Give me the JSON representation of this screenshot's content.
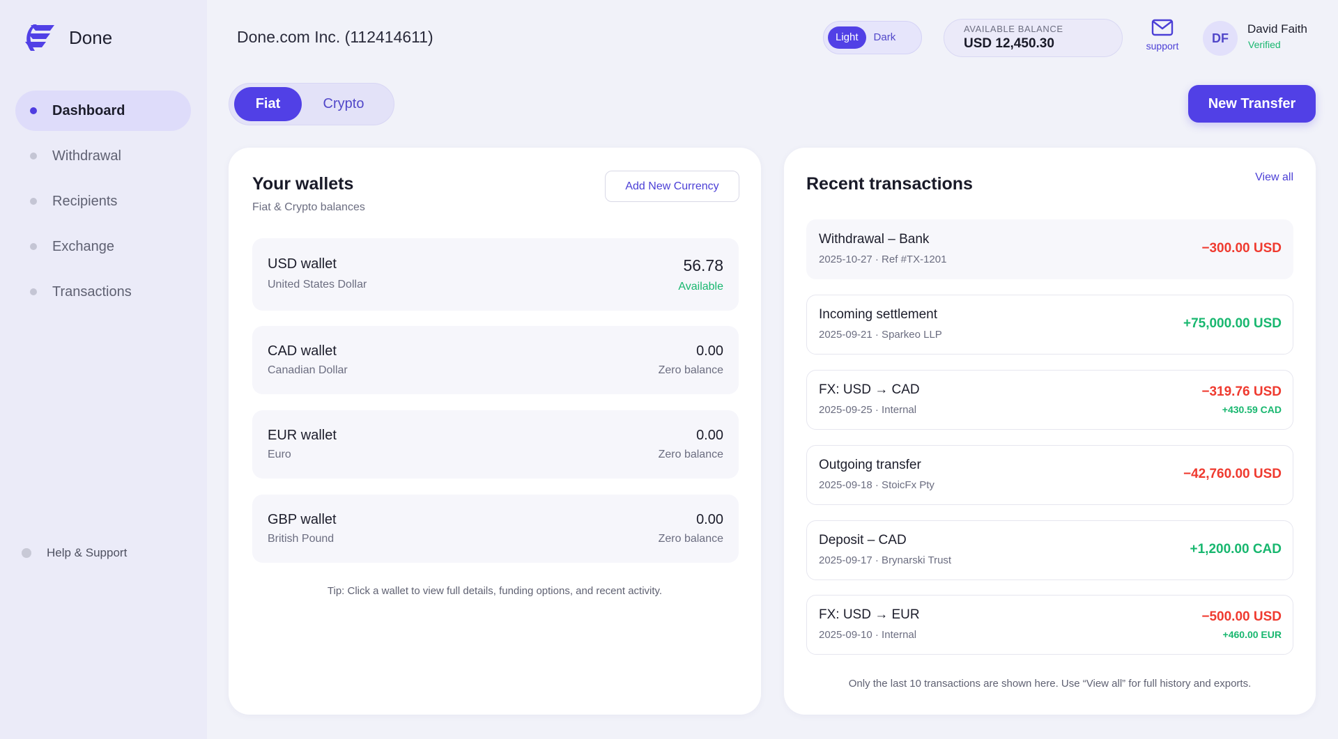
{
  "brand": {
    "name": "Done"
  },
  "sidebar": {
    "items": [
      {
        "label": "Dashboard",
        "active": true
      },
      {
        "label": "Withdrawal",
        "active": false
      },
      {
        "label": "Recipients",
        "active": false
      },
      {
        "label": "Exchange",
        "active": false
      },
      {
        "label": "Transactions",
        "active": false
      }
    ],
    "help_label": "Help & Support"
  },
  "header": {
    "company": "Done.com Inc. (112414611)",
    "theme": {
      "light": "Light",
      "dark": "Dark",
      "selected": "Light"
    },
    "balance": {
      "label": "AVAILABLE BALANCE",
      "value": "USD 12,450.30"
    },
    "support_label": "support",
    "user": {
      "initials": "DF",
      "name": "David Faith",
      "status": "Verified"
    }
  },
  "toolbar": {
    "segments": [
      "Fiat",
      "Crypto"
    ],
    "selected_segment": "Fiat",
    "new_transfer_label": "New Transfer"
  },
  "wallets": {
    "title": "Your wallets",
    "subtitle": "Fiat & Crypto balances",
    "add_label": "Add New Currency",
    "items": [
      {
        "name": "USD wallet",
        "currency": "United States Dollar",
        "amount": "56.78",
        "state": "Available"
      },
      {
        "name": "CAD wallet",
        "currency": "Canadian Dollar",
        "amount": "0.00",
        "state": "Zero balance"
      },
      {
        "name": "EUR wallet",
        "currency": "Euro",
        "amount": "0.00",
        "state": "Zero balance"
      },
      {
        "name": "GBP wallet",
        "currency": "British Pound",
        "amount": "0.00",
        "state": "Zero balance"
      }
    ],
    "tip": "Tip: Click a wallet to view full details, funding options, and recent activity."
  },
  "transactions": {
    "title": "Recent transactions",
    "view_all_label": "View all",
    "items": [
      {
        "title": "Withdrawal – Bank",
        "meta": "2025-10-27 · Ref #TX-1201",
        "amount": "−300.00 USD",
        "sub": ""
      },
      {
        "title": "Incoming settlement",
        "meta": "2025-09-21 · Sparkeo LLP",
        "amount": "+75,000.00 USD",
        "sub": ""
      },
      {
        "title": "FX: USD → CAD",
        "meta": "2025-09-25 · Internal",
        "amount": "−319.76 USD",
        "sub": "+430.59 CAD"
      },
      {
        "title": "Outgoing transfer",
        "meta": "2025-09-18 · StoicFx Pty",
        "amount": "−42,760.00 USD",
        "sub": ""
      },
      {
        "title": "Deposit – CAD",
        "meta": "2025-09-17 · Brynarski Trust",
        "amount": "+1,200.00 CAD",
        "sub": ""
      },
      {
        "title": "FX: USD → EUR",
        "meta": "2025-09-10 · Internal",
        "amount": "−500.00 USD",
        "sub": "+460.00 EUR"
      }
    ],
    "footer": "Only the last 10 transactions are shown here. Use “View all” for full history and exports."
  },
  "colors": {
    "accent": "#5140e6",
    "positive": "#18b76f",
    "negative": "#ef3a2f",
    "sidebar_bg": "#ebebf8",
    "page_bg": "#f1f2f9"
  },
  "icons": {
    "brand": "done-logo-icon",
    "support": "mail-icon"
  }
}
